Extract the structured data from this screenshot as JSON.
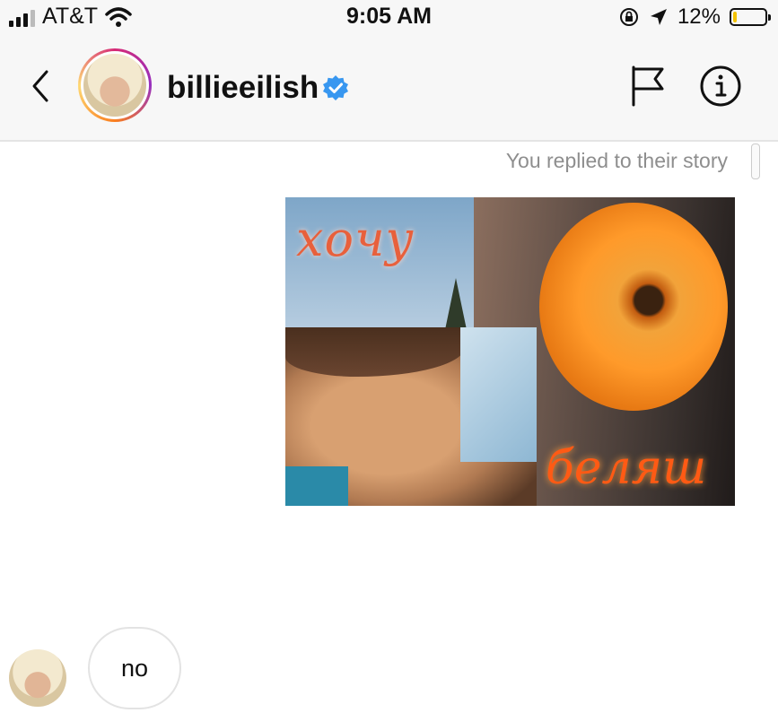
{
  "status_bar": {
    "carrier": "AT&T",
    "time": "9:05 AM",
    "battery_percent": "12%",
    "battery_level": 0.12,
    "icons": [
      "signal-icon",
      "wifi-icon",
      "orientation-lock-icon",
      "location-arrow-icon",
      "battery-icon"
    ]
  },
  "header": {
    "username": "billieeilish",
    "verified": true,
    "icons": [
      "back-chevron-icon",
      "flag-icon",
      "info-icon",
      "verified-badge-icon"
    ]
  },
  "chat": {
    "story_reply_note": "You replied to their story",
    "story_image": {
      "top_text": "хочу",
      "bottom_text": "беляш"
    },
    "messages": [
      {
        "sender": "billieeilish",
        "text": "no"
      }
    ]
  },
  "colors": {
    "verified_blue": "#3897f0",
    "battery_yellow": "#f3c200",
    "muted_gray": "#8e8e8e"
  }
}
